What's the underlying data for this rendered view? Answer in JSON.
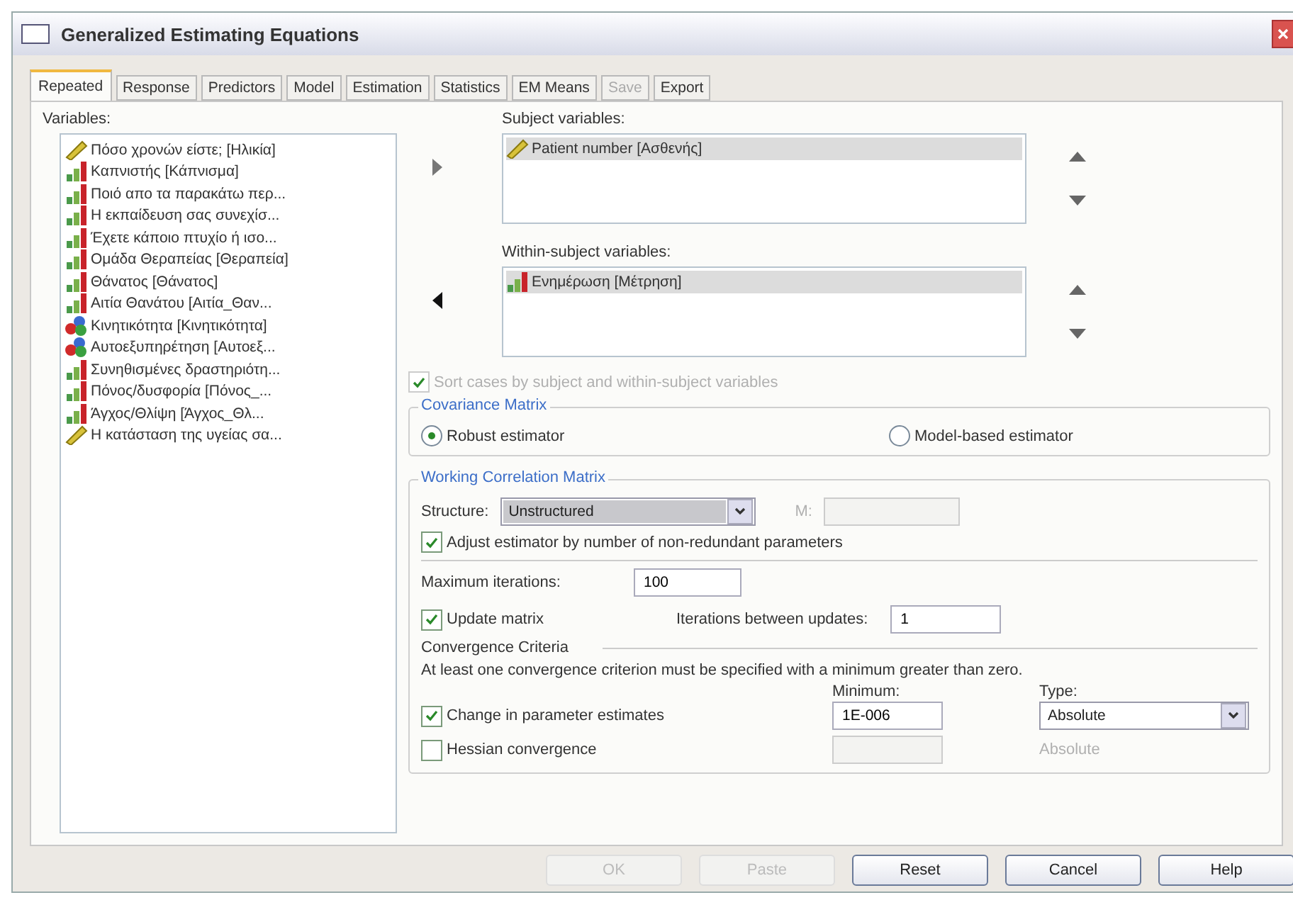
{
  "window": {
    "title": "Generalized Estimating Equations"
  },
  "tabs": [
    {
      "label": "Repeated",
      "selected": true,
      "disabled": false
    },
    {
      "label": "Response",
      "selected": false,
      "disabled": false
    },
    {
      "label": "Predictors",
      "selected": false,
      "disabled": false
    },
    {
      "label": "Model",
      "selected": false,
      "disabled": false
    },
    {
      "label": "Estimation",
      "selected": false,
      "disabled": false
    },
    {
      "label": "Statistics",
      "selected": false,
      "disabled": false
    },
    {
      "label": "EM Means",
      "selected": false,
      "disabled": false
    },
    {
      "label": "Save",
      "selected": false,
      "disabled": true
    },
    {
      "label": "Export",
      "selected": false,
      "disabled": false
    }
  ],
  "variables": {
    "label": "Variables:",
    "items": [
      {
        "label": "Πόσο χρονών είστε; [Ηλικία]",
        "kind": "scale"
      },
      {
        "label": "Καπνιστής [Κάπνισμα]",
        "kind": "ordinal"
      },
      {
        "label": "Ποιό απο τα παρακάτω περ...",
        "kind": "ordinal"
      },
      {
        "label": "Η εκπαίδευση σας συνεχίσ...",
        "kind": "ordinal"
      },
      {
        "label": "Έχετε κάποιο πτυχίο ή ισο...",
        "kind": "ordinal"
      },
      {
        "label": "Ομάδα Θεραπείας [Θεραπεία]",
        "kind": "ordinal"
      },
      {
        "label": "Θάνατος [Θάνατος]",
        "kind": "ordinal"
      },
      {
        "label": "Αιτία Θανάτου [Αιτία_Θαν...",
        "kind": "ordinal"
      },
      {
        "label": "Κινητικότητα [Κινητικότητα]",
        "kind": "nominal"
      },
      {
        "label": "Αυτοεξυπηρέτηση [Αυτοεξ...",
        "kind": "nominal"
      },
      {
        "label": "Συνηθισμένες δραστηριότη...",
        "kind": "ordinal"
      },
      {
        "label": "Πόνος/δυσφορία [Πόνος_...",
        "kind": "ordinal"
      },
      {
        "label": "Άγχος/Θλίψη [Άγχος_Θλ...",
        "kind": "ordinal"
      },
      {
        "label": "Η κατάσταση της υγείας σα...",
        "kind": "scale"
      }
    ]
  },
  "subject_variables": {
    "label": "Subject variables:",
    "items": [
      {
        "label": "Patient number [Ασθενής]",
        "kind": "scale",
        "selected": true
      }
    ]
  },
  "within_subject_variables": {
    "label": "Within-subject variables:",
    "items": [
      {
        "label": "Ενημέρωση [Μέτρηση]",
        "kind": "ordinal",
        "selected": true
      }
    ]
  },
  "sort_cases": {
    "label": "Sort cases by subject and within-subject variables",
    "checked": true,
    "disabled": true
  },
  "covariance_matrix": {
    "title": "Covariance Matrix",
    "options": [
      {
        "label": "Robust estimator",
        "selected": true
      },
      {
        "label": "Model-based estimator",
        "selected": false
      }
    ]
  },
  "working_correlation_matrix": {
    "title": "Working Correlation Matrix",
    "structure_label": "Structure:",
    "structure_value": "Unstructured",
    "m_label": "M:",
    "adjust": {
      "label": "Adjust estimator by number of non-redundant parameters",
      "checked": true
    },
    "max_iterations_label": "Maximum iterations:",
    "max_iterations_value": "100",
    "update_matrix": {
      "label": "Update matrix",
      "checked": true
    },
    "iterations_between_label": "Iterations between updates:",
    "iterations_between_value": "1"
  },
  "convergence_criteria": {
    "title": "Convergence Criteria",
    "note": "At least one convergence criterion must be specified with a minimum greater than zero.",
    "minimum_header": "Minimum:",
    "type_header": "Type:",
    "rows": [
      {
        "label": "Change in parameter estimates",
        "checked": true,
        "minimum": "1E-006",
        "type": "Absolute"
      },
      {
        "label": "Hessian convergence",
        "checked": false,
        "type": "Absolute"
      }
    ]
  },
  "buttons": [
    {
      "label": "OK",
      "disabled": true
    },
    {
      "label": "Paste",
      "disabled": true
    },
    {
      "label": "Reset",
      "disabled": false
    },
    {
      "label": "Cancel",
      "disabled": false
    },
    {
      "label": "Help",
      "disabled": false
    }
  ]
}
